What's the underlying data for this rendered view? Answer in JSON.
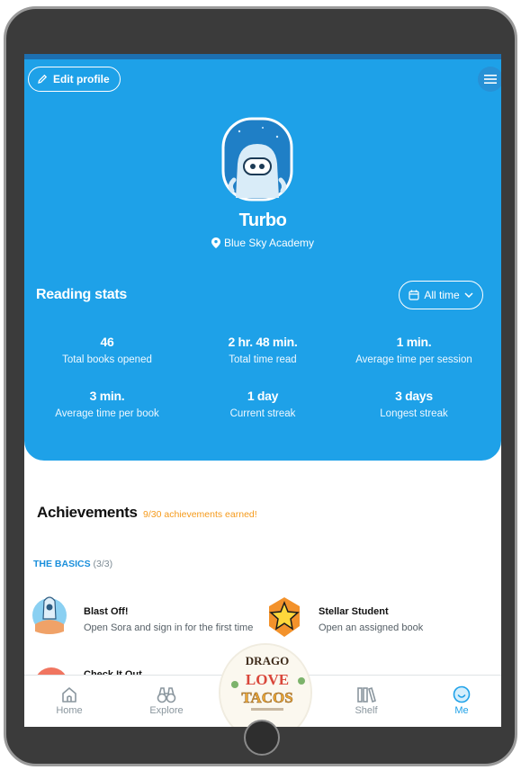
{
  "profile": {
    "edit_label": "Edit profile",
    "name": "Turbo",
    "school": "Blue Sky Academy"
  },
  "stats": {
    "title": "Reading stats",
    "filter": "All time",
    "items": [
      {
        "value": "46",
        "label": "Total books opened"
      },
      {
        "value": "2 hr. 48 min.",
        "label": "Total time read"
      },
      {
        "value": "1 min.",
        "label": "Average time per session"
      },
      {
        "value": "3 min.",
        "label": "Average time per book"
      },
      {
        "value": "1 day",
        "label": "Current streak"
      },
      {
        "value": "3 days",
        "label": "Longest streak"
      }
    ]
  },
  "achievements": {
    "title": "Achievements",
    "earned": "9/30 achievements earned!",
    "section": "THE BASICS",
    "section_count": "(3/3)",
    "items": [
      {
        "name": "Blast Off!",
        "desc": "Open Sora and sign in for the first time"
      },
      {
        "name": "Stellar Student",
        "desc": "Open an assigned book"
      },
      {
        "name": "Check It Out",
        "desc": ""
      }
    ]
  },
  "book": {
    "title_line1": "LOVE",
    "title_line2": "TACOS",
    "top_text": "DRAGO"
  },
  "tabs": [
    {
      "label": "Home"
    },
    {
      "label": "Explore"
    },
    {
      "label": "Shelf"
    },
    {
      "label": "Me"
    }
  ],
  "colors": {
    "primary": "#1ea1e8",
    "accent_orange": "#f59a1b",
    "active_tab": "#1ea1e8"
  }
}
